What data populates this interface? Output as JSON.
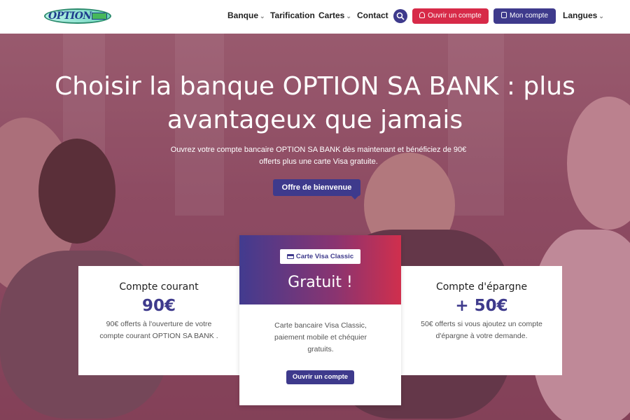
{
  "brand": {
    "logo_text": "OPTION"
  },
  "nav": {
    "items": [
      {
        "label": "Banque",
        "has_dropdown": true
      },
      {
        "label": "Tarification",
        "has_dropdown": false
      },
      {
        "label": "Cartes",
        "has_dropdown": true
      },
      {
        "label": "Contact",
        "has_dropdown": false
      }
    ],
    "search_icon": "search-icon",
    "open_account_label": "Ouvrir un compte",
    "my_account_label": "Mon compte",
    "languages_label": "Langues"
  },
  "hero": {
    "title": "Choisir la banque OPTION SA BANK : plus avantageux que jamais",
    "subtitle": "Ouvrez votre compte bancaire OPTION SA BANK dès maintenant et bénéficiez de 90€ offerts plus une carte Visa gratuite.",
    "cta_label": "Offre de bienvenue"
  },
  "cards": {
    "left": {
      "title": "Compte courant",
      "value": "90€",
      "description": "90€ offerts à l'ouverture de votre compte courant OPTION SA BANK ."
    },
    "middle": {
      "badge": "Carte Visa Classic",
      "headline": "Gratuit !",
      "description": "Carte bancaire Visa Classic, paiement mobile et chéquier gratuits.",
      "button_label": "Ouvrir un compte"
    },
    "right": {
      "title": "Compte d'épargne",
      "value": "+ 50€",
      "description": "50€ offerts si vous ajoutez un compte d'épargne à votre demande."
    }
  },
  "colors": {
    "primary": "#3e3a8c",
    "accent": "#d72a48",
    "hero_tint": "#8d5066"
  }
}
